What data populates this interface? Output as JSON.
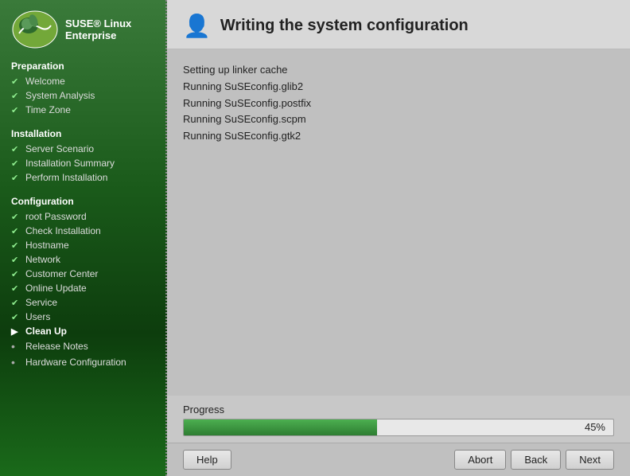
{
  "sidebar": {
    "brand_line1": "SUSE® Linux",
    "brand_line2": "Enterprise",
    "sections": [
      {
        "label": "Preparation",
        "items": [
          {
            "name": "Welcome",
            "state": "check",
            "active": false
          },
          {
            "name": "System Analysis",
            "state": "check",
            "active": false
          },
          {
            "name": "Time Zone",
            "state": "check",
            "active": false
          }
        ]
      },
      {
        "label": "Installation",
        "items": [
          {
            "name": "Server Scenario",
            "state": "check",
            "active": false
          },
          {
            "name": "Installation Summary",
            "state": "check",
            "active": false
          },
          {
            "name": "Perform Installation",
            "state": "check",
            "active": false
          }
        ]
      },
      {
        "label": "Configuration",
        "items": [
          {
            "name": "root Password",
            "state": "check",
            "active": false
          },
          {
            "name": "Check Installation",
            "state": "check",
            "active": false
          },
          {
            "name": "Hostname",
            "state": "check",
            "active": false
          },
          {
            "name": "Network",
            "state": "check",
            "active": false
          },
          {
            "name": "Customer Center",
            "state": "check",
            "active": false
          },
          {
            "name": "Online Update",
            "state": "check",
            "active": false
          },
          {
            "name": "Service",
            "state": "check",
            "active": false
          },
          {
            "name": "Users",
            "state": "check",
            "active": false
          },
          {
            "name": "Clean Up",
            "state": "arrow",
            "active": true
          },
          {
            "name": "Release Notes",
            "state": "bullet",
            "active": false
          },
          {
            "name": "Hardware Configuration",
            "state": "bullet",
            "active": false
          }
        ]
      }
    ]
  },
  "main": {
    "title": "Writing the system configuration",
    "icon": "👤",
    "log_lines": [
      "Setting up linker cache",
      "Running SuSEconfig.glib2",
      "Running SuSEconfig.postfix",
      "Running SuSEconfig.scpm",
      "Running SuSEconfig.gtk2"
    ],
    "progress": {
      "label": "Progress",
      "percent": 45,
      "percent_text": "45%"
    }
  },
  "footer": {
    "help_label": "Help",
    "abort_label": "Abort",
    "back_label": "Back",
    "next_label": "Next"
  }
}
